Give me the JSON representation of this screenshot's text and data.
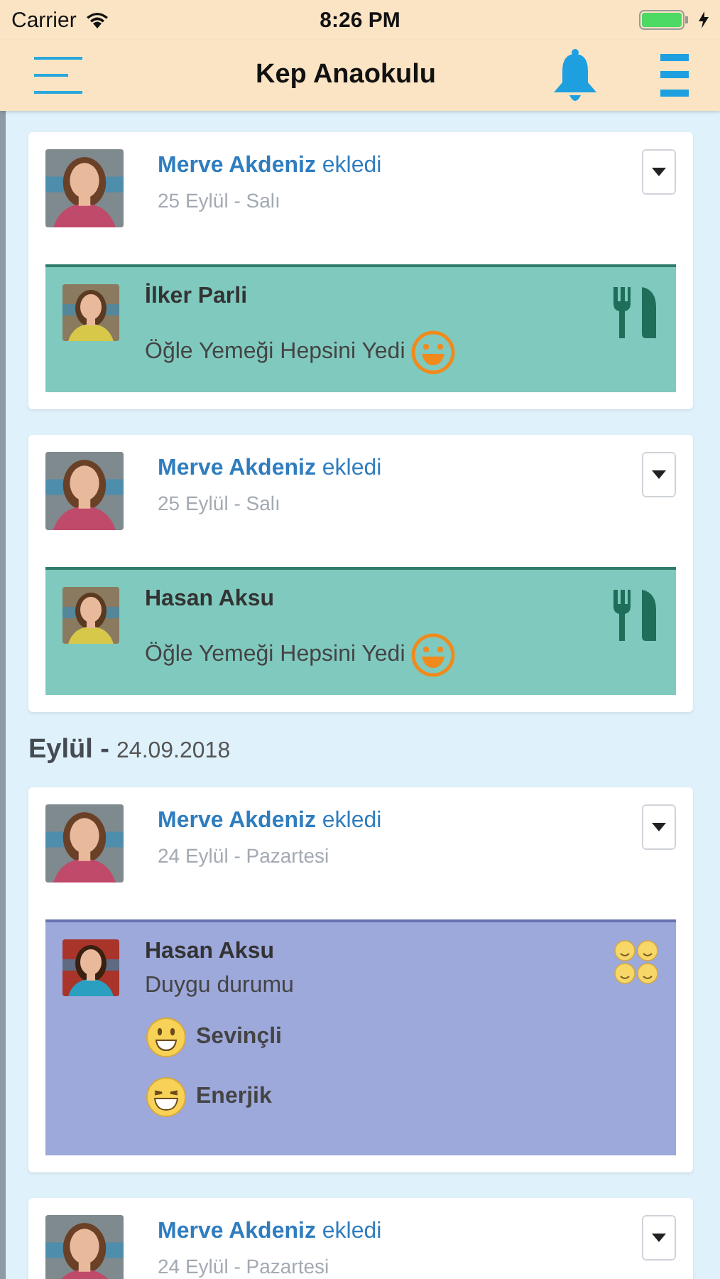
{
  "status_bar": {
    "carrier": "Carrier",
    "time": "8:26 PM"
  },
  "nav_bar": {
    "title": "Kep Anaokulu"
  },
  "feed": [
    {
      "kind": "post",
      "author": "**Merve Akdeniz** ekledi",
      "date": "25 Eylül - Salı",
      "activity": {
        "kind": "meal",
        "child": "İlker Parli",
        "text": "Öğle Yemeği Hepsini Yedi"
      }
    },
    {
      "kind": "post",
      "author": "**Merve Akdeniz** ekledi",
      "date": "25 Eylül - Salı",
      "activity": {
        "kind": "meal",
        "child": "Hasan Aksu",
        "text": "Öğle Yemeği Hepsini Yedi"
      }
    },
    {
      "kind": "section",
      "month": "Eylül -",
      "date": "24.09.2018"
    },
    {
      "kind": "post",
      "author": "**Merve Akdeniz** ekledi",
      "date": "24 Eylül - Pazartesi",
      "activity": {
        "kind": "mood",
        "child": "Hasan Aksu",
        "text": "Duygu durumu",
        "moods": [
          {
            "kind": "grin",
            "label": "Sevinçli"
          },
          {
            "kind": "laugh",
            "label": "Enerjik"
          }
        ]
      }
    },
    {
      "kind": "post",
      "author": "**Merve Akdeniz** ekledi",
      "date": "24 Eylül - Pazartesi"
    }
  ]
}
